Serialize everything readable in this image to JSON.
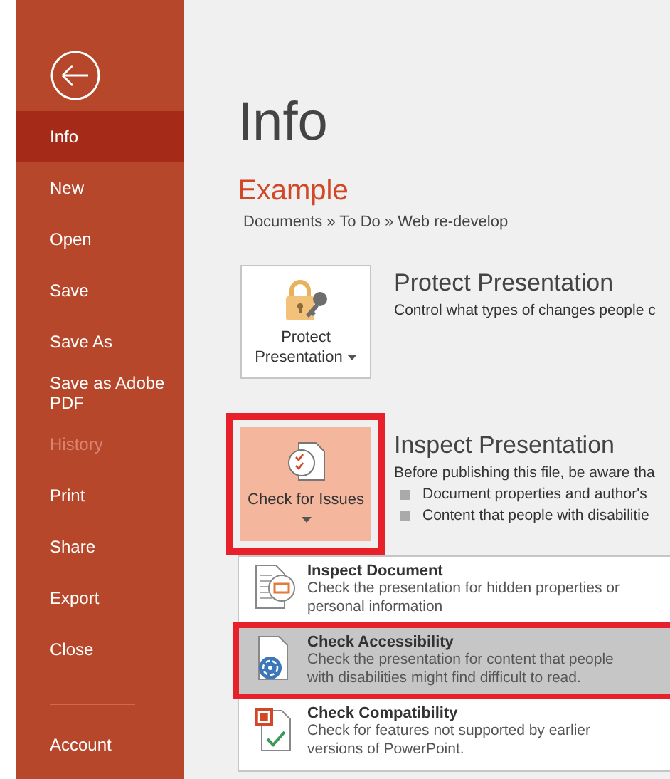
{
  "sidebar": {
    "items": [
      {
        "label": "Info",
        "selected": true,
        "disabled": false
      },
      {
        "label": "New",
        "selected": false,
        "disabled": false
      },
      {
        "label": "Open",
        "selected": false,
        "disabled": false
      },
      {
        "label": "Save",
        "selected": false,
        "disabled": false
      },
      {
        "label": "Save As",
        "selected": false,
        "disabled": false
      },
      {
        "label": "Save as Adobe PDF",
        "selected": false,
        "disabled": false
      },
      {
        "label": "History",
        "selected": false,
        "disabled": true
      },
      {
        "label": "Print",
        "selected": false,
        "disabled": false
      },
      {
        "label": "Share",
        "selected": false,
        "disabled": false
      },
      {
        "label": "Export",
        "selected": false,
        "disabled": false
      },
      {
        "label": "Close",
        "selected": false,
        "disabled": false
      }
    ],
    "footer_items": [
      {
        "label": "Account",
        "selected": false,
        "disabled": false
      }
    ]
  },
  "main": {
    "title": "Info",
    "document_name": "Example",
    "breadcrumb": "Documents » To Do » Web re-develop",
    "sections": [
      {
        "kind": "protect",
        "button": {
          "label": "Protect Presentation",
          "pressed": false,
          "highlighted": false
        },
        "heading": "Protect Presentation",
        "description": "Control what types of changes people c"
      },
      {
        "kind": "check",
        "button": {
          "label": "Check for Issues",
          "pressed": true,
          "highlighted": true
        },
        "heading": "Inspect Presentation",
        "description": "Before publishing this file, be aware tha",
        "bullets": [
          "Document properties and author's",
          "Content that people with disabilitie"
        ]
      }
    ],
    "menu": {
      "items": [
        {
          "kind": "inspect",
          "title": "Inspect Document",
          "description": "Check the presentation for hidden properties or personal information",
          "selected": false,
          "highlighted": false
        },
        {
          "kind": "accessibility",
          "title": "Check Accessibility",
          "description": "Check the presentation for content that people with disabilities might find difficult to read.",
          "selected": true,
          "highlighted": true
        },
        {
          "kind": "compatibility",
          "title": "Check Compatibility",
          "description": "Check for features not supported by earlier versions of PowerPoint.",
          "selected": false,
          "highlighted": false
        }
      ]
    }
  }
}
